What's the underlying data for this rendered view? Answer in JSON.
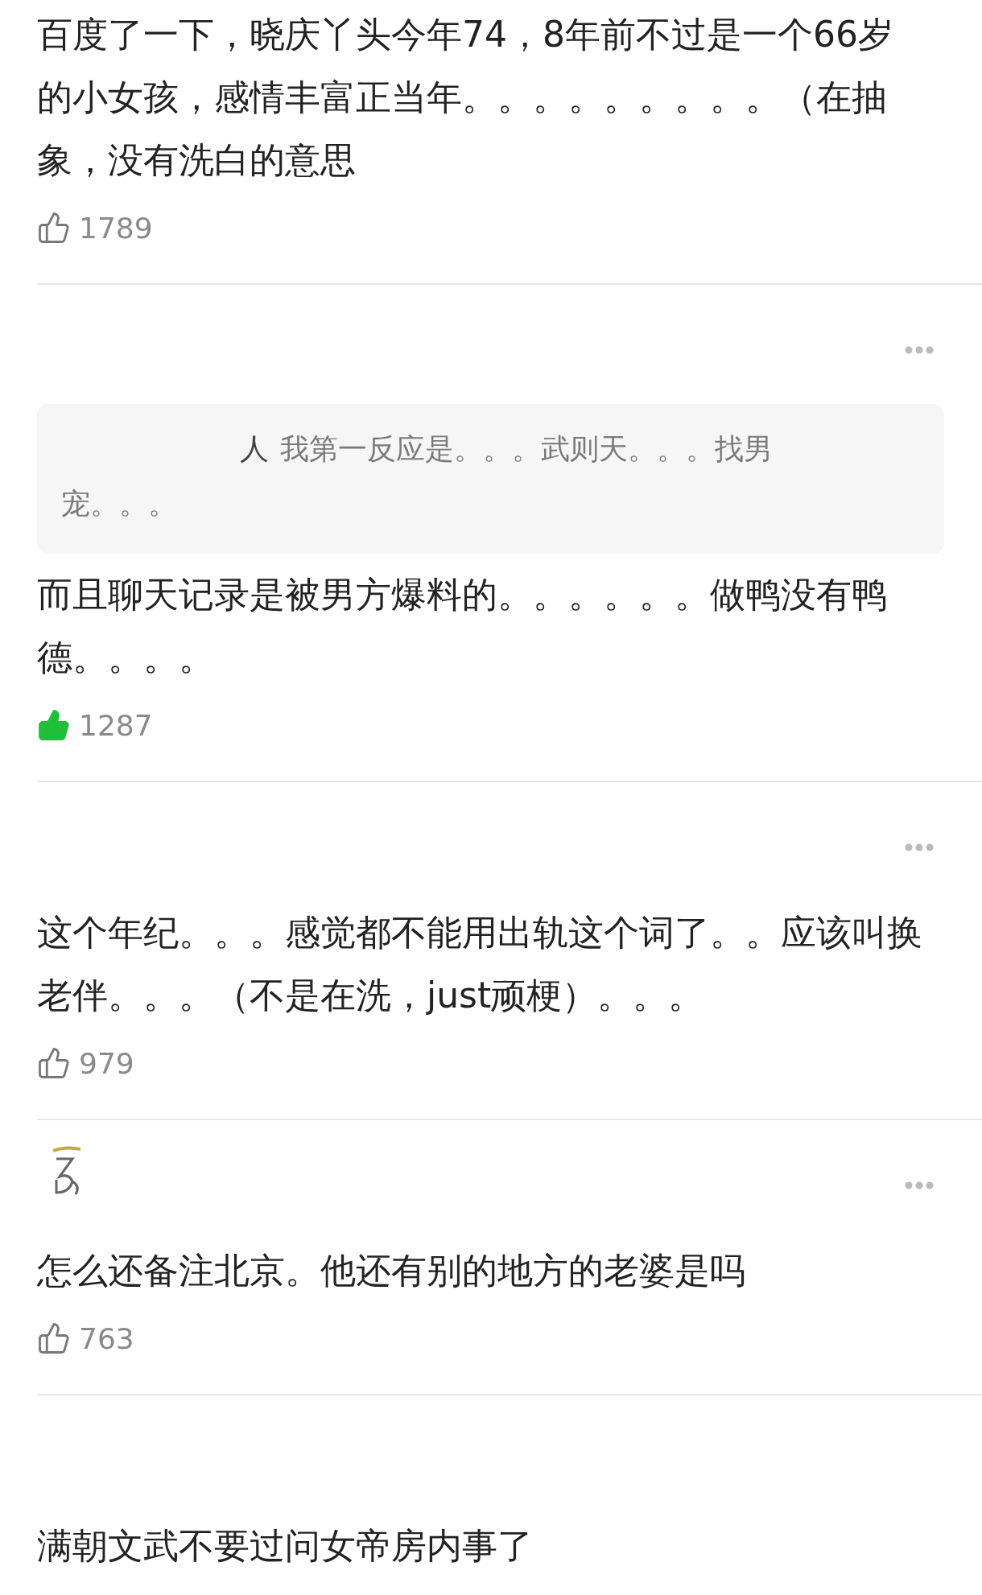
{
  "comments": [
    {
      "has_menu": false,
      "avatar": false,
      "text": "百度了一下，晓庆丫头今年74，8年前不过是一个66岁的小女孩，感情丰富正当年。。。。。。。。。（在抽象，没有洗白的意思",
      "likes": {
        "count": "1789",
        "liked": false
      }
    },
    {
      "has_menu": true,
      "avatar": false,
      "quote": {
        "author_fragment": "人",
        "text": "我第一反应是。。。武则天。。。找男宠。。。"
      },
      "text": "而且聊天记录是被男方爆料的。。。。。。做鸭没有鸭德。。。。",
      "likes": {
        "count": "1287",
        "liked": true
      }
    },
    {
      "has_menu": true,
      "avatar": false,
      "text": "这个年纪。。。感觉都不能用出轨这个词了。。应该叫换老伴。。。（不是在洗，just顽梗）。。。",
      "likes": {
        "count": "979",
        "liked": false
      }
    },
    {
      "has_menu": true,
      "avatar": true,
      "text": "怎么还备注北京。他还有别的地方的老婆是吗",
      "likes": {
        "count": "763",
        "liked": false
      }
    },
    {
      "has_menu": false,
      "avatar": false,
      "text": "满朝文武不要过问女帝房内事了"
    }
  ]
}
